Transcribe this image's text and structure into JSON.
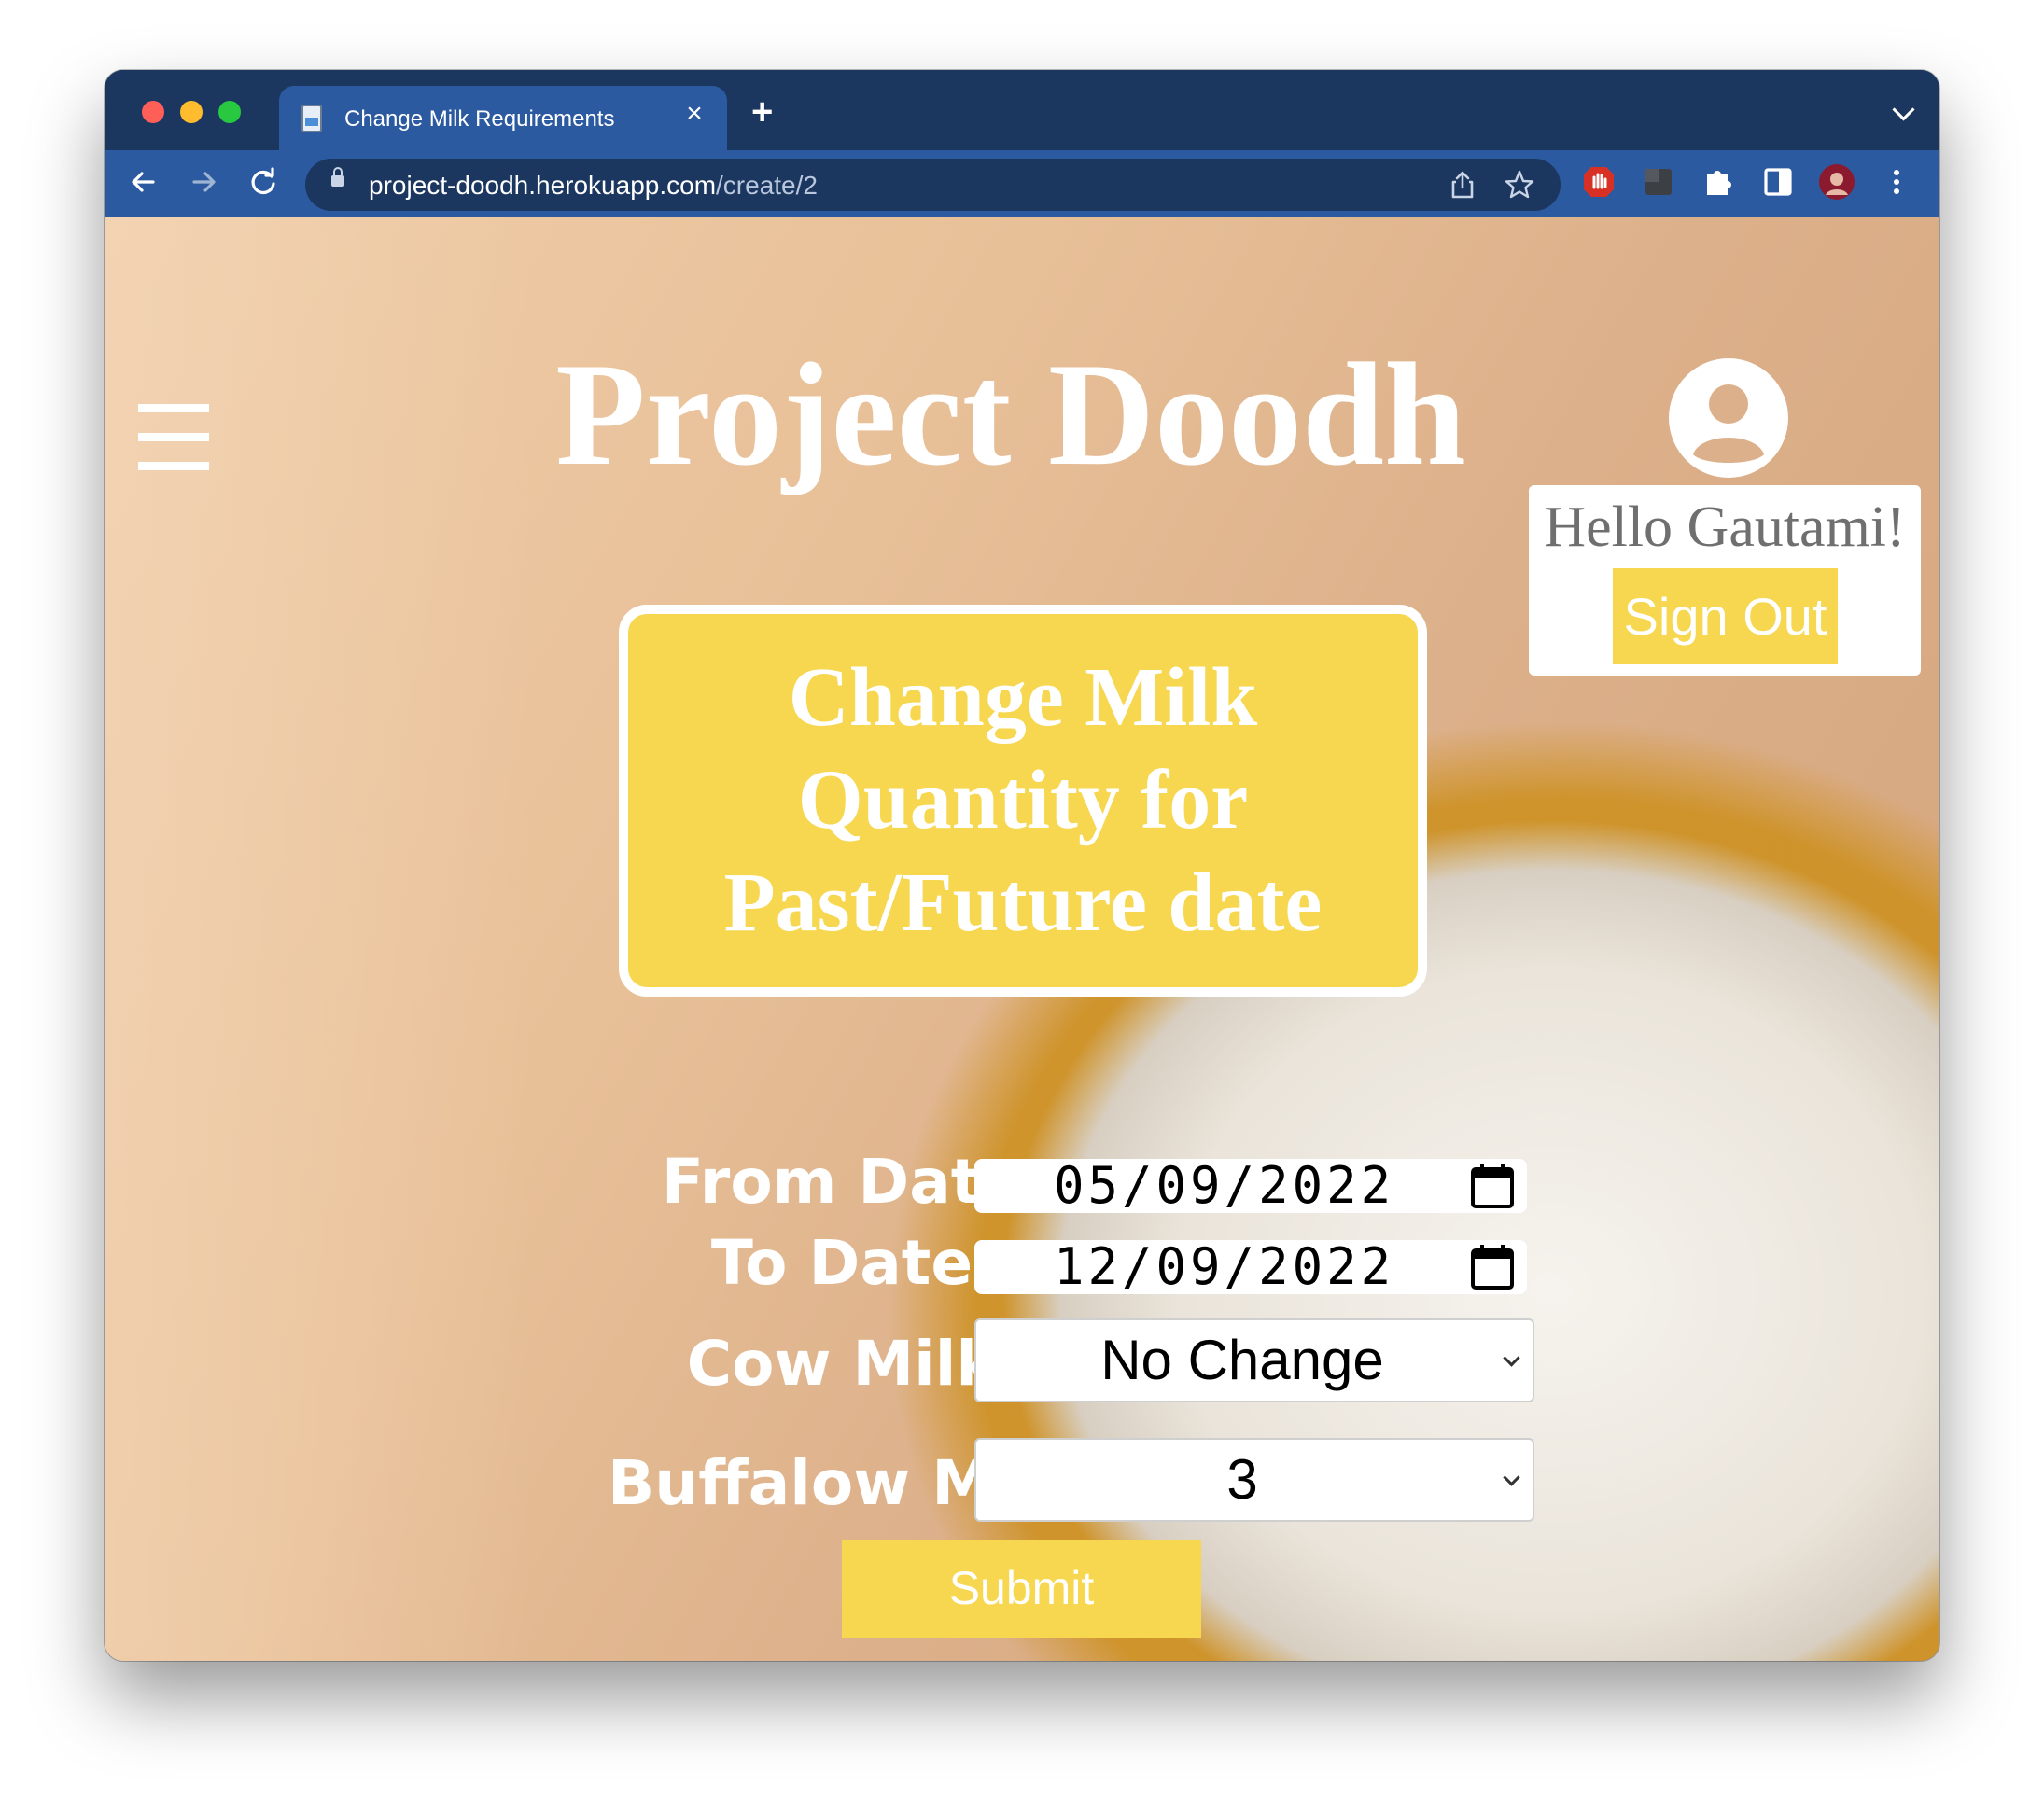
{
  "browser": {
    "tab_title": "Change Milk Requirements",
    "new_tab_label": "+",
    "url_host": "project-doodh.herokuapp.com",
    "url_path": "/create/2"
  },
  "header": {
    "site_title": "Project Doodh"
  },
  "user_card": {
    "greeting": "Hello Gautami!",
    "signout_label": "Sign Out"
  },
  "banner": {
    "heading_lines": [
      "Change Milk",
      "Quantity for",
      "Past/Future date"
    ]
  },
  "form": {
    "from_date_label": "From Date",
    "from_date_value": "05/09/2022",
    "to_date_label": "To Date",
    "to_date_value": "12/09/2022",
    "cow_milk_label": "Cow Milk",
    "cow_milk_value": "No Change",
    "buffalo_milk_label": "Buffalow Milk",
    "buffalo_milk_value": "3",
    "submit_label": "Submit"
  },
  "colors": {
    "chrome_dark": "#1b365f",
    "chrome_blue": "#2c5aa0",
    "accent_yellow": "#f6d74f"
  },
  "icons": [
    "back-icon",
    "forward-icon",
    "reload-icon",
    "lock-icon",
    "share-icon",
    "star-icon",
    "adblock-icon",
    "extension-box-icon",
    "puzzle-icon",
    "sidepanel-icon",
    "profile-avatar-icon",
    "kebab-menu-icon",
    "hamburger-menu-icon",
    "account-icon",
    "calendar-icon"
  ]
}
